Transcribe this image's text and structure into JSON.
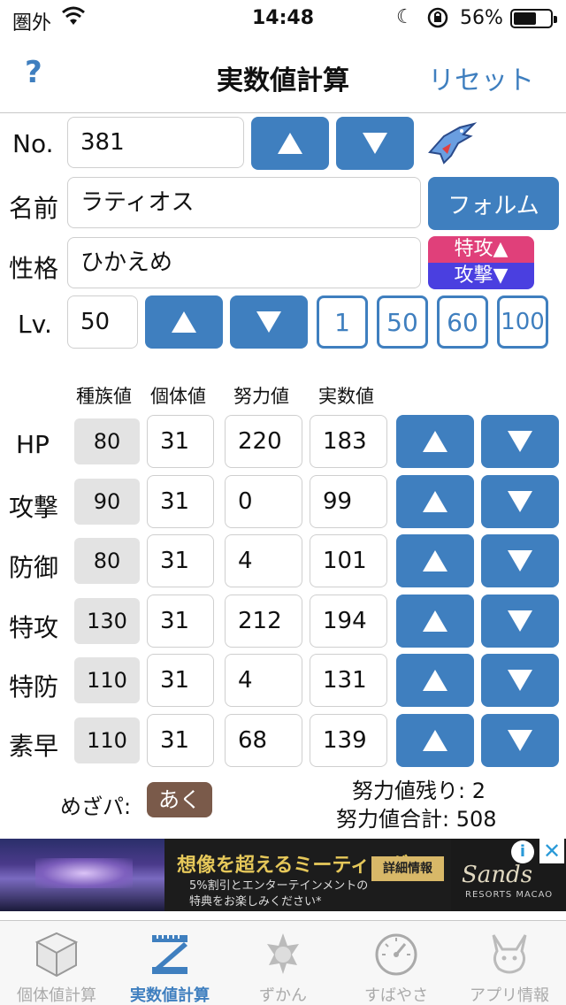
{
  "status": {
    "carrier": "圏外",
    "time": "14:48",
    "battery": "56%"
  },
  "nav": {
    "help": "?",
    "title": "実数値計算",
    "reset": "リセット"
  },
  "form": {
    "no_label": "No.",
    "no_value": "381",
    "name_label": "名前",
    "name_value": "ラティオス",
    "form_button": "フォルム",
    "nature_label": "性格",
    "nature_value": "ひかえめ",
    "nature_up": "特攻▲",
    "nature_down": "攻撃▼",
    "lv_label": "Lv.",
    "lv_value": "50",
    "lv_presets": [
      "1",
      "50",
      "60",
      "100"
    ]
  },
  "headers": [
    "種族値",
    "個体値",
    "努力値",
    "実数値"
  ],
  "stats": [
    {
      "name": "HP",
      "base": "80",
      "iv": "31",
      "ev": "220",
      "value": "183"
    },
    {
      "name": "攻撃",
      "base": "90",
      "iv": "31",
      "ev": "0",
      "value": "99"
    },
    {
      "name": "防御",
      "base": "80",
      "iv": "31",
      "ev": "4",
      "value": "101"
    },
    {
      "name": "特攻",
      "base": "130",
      "iv": "31",
      "ev": "212",
      "value": "194"
    },
    {
      "name": "特防",
      "base": "110",
      "iv": "31",
      "ev": "4",
      "value": "131"
    },
    {
      "name": "素早",
      "base": "110",
      "iv": "31",
      "ev": "68",
      "value": "139"
    }
  ],
  "footer": {
    "hidden_power_label": "めざパ:",
    "hidden_power_type": "あく",
    "ev_remaining": "努力値残り: 2",
    "ev_total": "努力値合計: 508"
  },
  "ad": {
    "headline": "想像を超えるミーティング",
    "line1": "5%割引とエンターテインメントの",
    "line2": "特典をお楽しみください*",
    "detail": "詳細情報",
    "brand": "Sands",
    "brand_sub": "RESORTS MACAO",
    "info": "i",
    "close": "✕"
  },
  "tabs": [
    {
      "label": "個体値計算",
      "icon": "cube-icon"
    },
    {
      "label": "実数値計算",
      "icon": "ruler-z-icon"
    },
    {
      "label": "ずかん",
      "icon": "pokemon-silhouette-icon"
    },
    {
      "label": "すばやさ",
      "icon": "speedometer-icon"
    },
    {
      "label": "アプリ情報",
      "icon": "pikachu-icon"
    }
  ],
  "colors": {
    "accent": "#3f7fbf",
    "nature_up": "#e0407a",
    "nature_down": "#4a3fe0",
    "hp_type": "#7a5a4a"
  }
}
